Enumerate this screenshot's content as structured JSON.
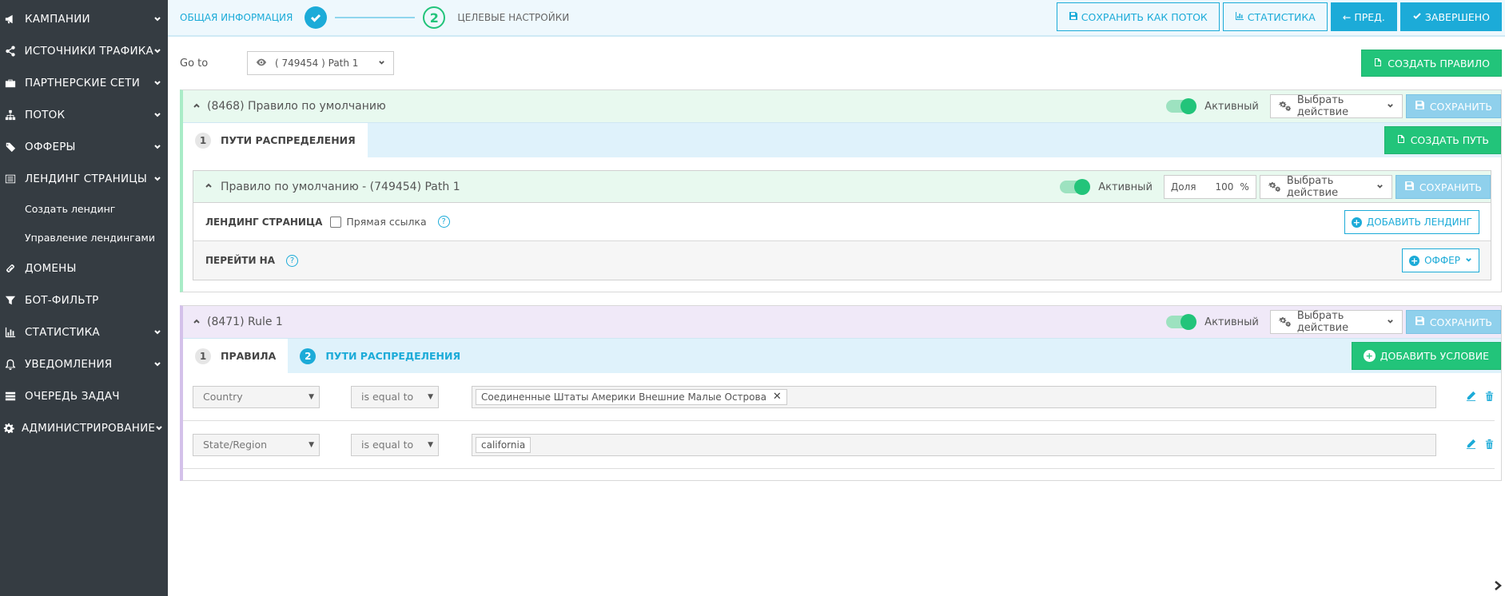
{
  "sidebar": {
    "items": [
      {
        "label": "КАМПАНИИ",
        "icon": "megaphone-icon",
        "has_chevron": true
      },
      {
        "label": "ИСТОЧНИКИ ТРАФИКА",
        "icon": "share-icon",
        "has_chevron": true
      },
      {
        "label": "ПАРТНЕРСКИЕ СЕТИ",
        "icon": "briefcase-icon",
        "has_chevron": true
      },
      {
        "label": "ПОТОК",
        "icon": "sitemap-icon",
        "has_chevron": true
      },
      {
        "label": "ОФФЕРЫ",
        "icon": "tags-icon",
        "has_chevron": true
      },
      {
        "label": "ЛЕНДИНГ СТРАНИЦЫ",
        "icon": "list-alt-icon",
        "has_chevron": true
      },
      {
        "label": "ДОМЕНЫ",
        "icon": "link-icon",
        "has_chevron": false
      },
      {
        "label": "БОТ-ФИЛЬТР",
        "icon": "filter-icon",
        "has_chevron": false
      },
      {
        "label": "СТАТИСТИКА",
        "icon": "bar-chart-icon",
        "has_chevron": true
      },
      {
        "label": "УВЕДОМЛЕНИЯ",
        "icon": "bell-icon",
        "has_chevron": true
      },
      {
        "label": "ОЧЕРЕДЬ ЗАДАЧ",
        "icon": "server-icon",
        "has_chevron": false
      },
      {
        "label": "АДМИНИСТРИРОВАНИЕ",
        "icon": "gear-icon",
        "has_chevron": true
      }
    ],
    "landing_sub": [
      "Создать лендинг",
      "Управление лендингами"
    ]
  },
  "wizard": {
    "step1_label": "ОБЩАЯ ИНФОРМАЦИЯ",
    "step2_number": "2",
    "step2_label": "ЦЕЛЕВЫЕ НАСТРОЙКИ"
  },
  "top_actions": {
    "save_as_flow": "СОХРАНИТЬ КАК ПОТОК",
    "statistics": "СТАТИСТИКА",
    "prev": "ПРЕД.",
    "done": "ЗАВЕРШЕНО"
  },
  "goto": {
    "label": "Go to",
    "value": "( 749454 ) Path 1",
    "create_rule": "СОЗДАТЬ ПРАВИЛО"
  },
  "rule1": {
    "title": "(8468) Правило по умолчанию",
    "active_label": "Активный",
    "action_select": "Выбрать действие",
    "save": "СОХРАНИТЬ",
    "tab_number": "1",
    "tab_label": "ПУТИ РАСПРЕДЕЛЕНИЯ",
    "create_path": "СОЗДАТЬ ПУТЬ",
    "path": {
      "title": "Правило по умолчанию - (749454) Path 1",
      "active_label": "Активный",
      "share_label": "Доля",
      "share_value": "100",
      "share_unit": "%",
      "action_select": "Выбрать действие",
      "save": "СОХРАНИТЬ",
      "landing_label": "ЛЕНДИНГ СТРАНИЦА",
      "direct_link_label": "Прямая ссылка",
      "direct_link_checked": false,
      "add_landing": "ДОБАВИТЬ ЛЕНДИНГ",
      "goto_label": "ПЕРЕЙТИ НА",
      "offer": "ОФФЕР"
    }
  },
  "rule2": {
    "title": "(8471) Rule 1",
    "active_label": "Активный",
    "action_select": "Выбрать действие",
    "save": "СОХРАНИТЬ",
    "tab1_number": "1",
    "tab1_label": "ПРАВИЛА",
    "tab2_number": "2",
    "tab2_label": "ПУТИ РАСПРЕДЕЛЕНИЯ",
    "add_condition": "ДОБАВИТЬ УСЛОВИЕ",
    "conditions": [
      {
        "field": "Country",
        "operator": "is equal to",
        "value": "Соединенные Штаты Америки Внешние Малые Острова",
        "removable": true
      },
      {
        "field": "State/Region",
        "operator": "is equal to",
        "value": "california",
        "removable": false
      }
    ]
  },
  "colors": {
    "sidebar_bg": "#353c42",
    "accent_blue": "#1cabd8",
    "accent_green": "#22c47a",
    "rule_purple": "#d4c1ea"
  }
}
